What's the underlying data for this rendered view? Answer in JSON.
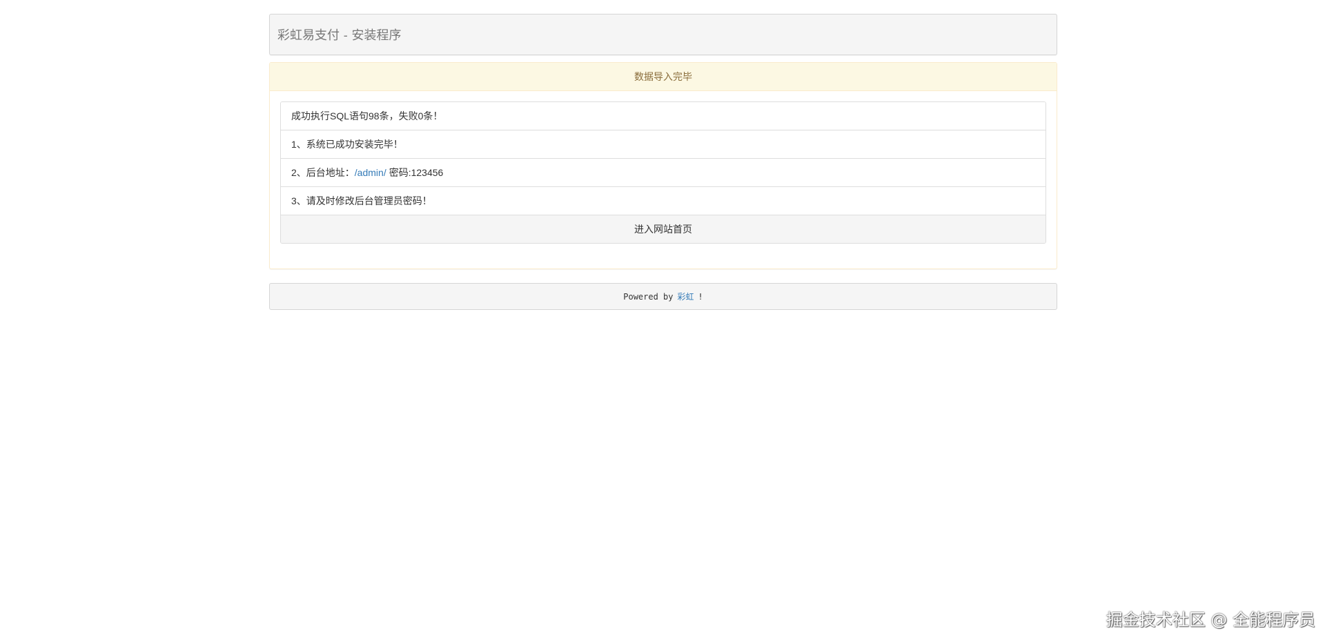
{
  "header": {
    "title": "彩虹易支付 - 安装程序"
  },
  "panel": {
    "heading": "数据导入完毕",
    "items": {
      "sql_result": "成功执行SQL语句98条，失败0条！",
      "step1": "1、系统已成功安装完毕！",
      "step2_prefix": "2、后台地址：",
      "step2_link": "/admin/",
      "step2_suffix": "密码:123456",
      "step3": "3、请及时修改后台管理员密码！"
    },
    "home_button": "进入网站首页"
  },
  "footer": {
    "prefix": "Powered by",
    "link": "彩虹",
    "suffix": "!"
  },
  "watermark": "掘金技术社区 @ 全能程序员",
  "colors": {
    "link": "#337ab7",
    "warning_bg": "#fcf8e3",
    "warning_text": "#8a6d3b",
    "panel_bg": "#f5f5f5"
  }
}
